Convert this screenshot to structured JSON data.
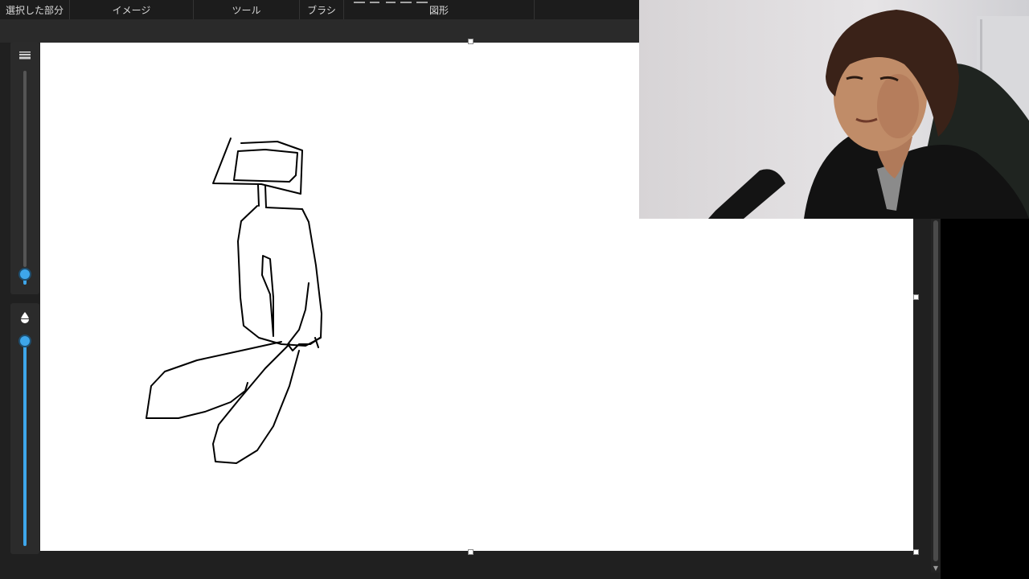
{
  "ribbon": {
    "groups": [
      {
        "label": "選択した部分"
      },
      {
        "label": "イメージ"
      },
      {
        "label": "ツール"
      },
      {
        "label": "ブラシ"
      },
      {
        "label": "図形"
      }
    ]
  },
  "sliders": {
    "size_icon": "brush-size-icon",
    "opacity_icon": "opacity-drop-icon"
  },
  "icons": {
    "accent": "#3ea6ea"
  }
}
